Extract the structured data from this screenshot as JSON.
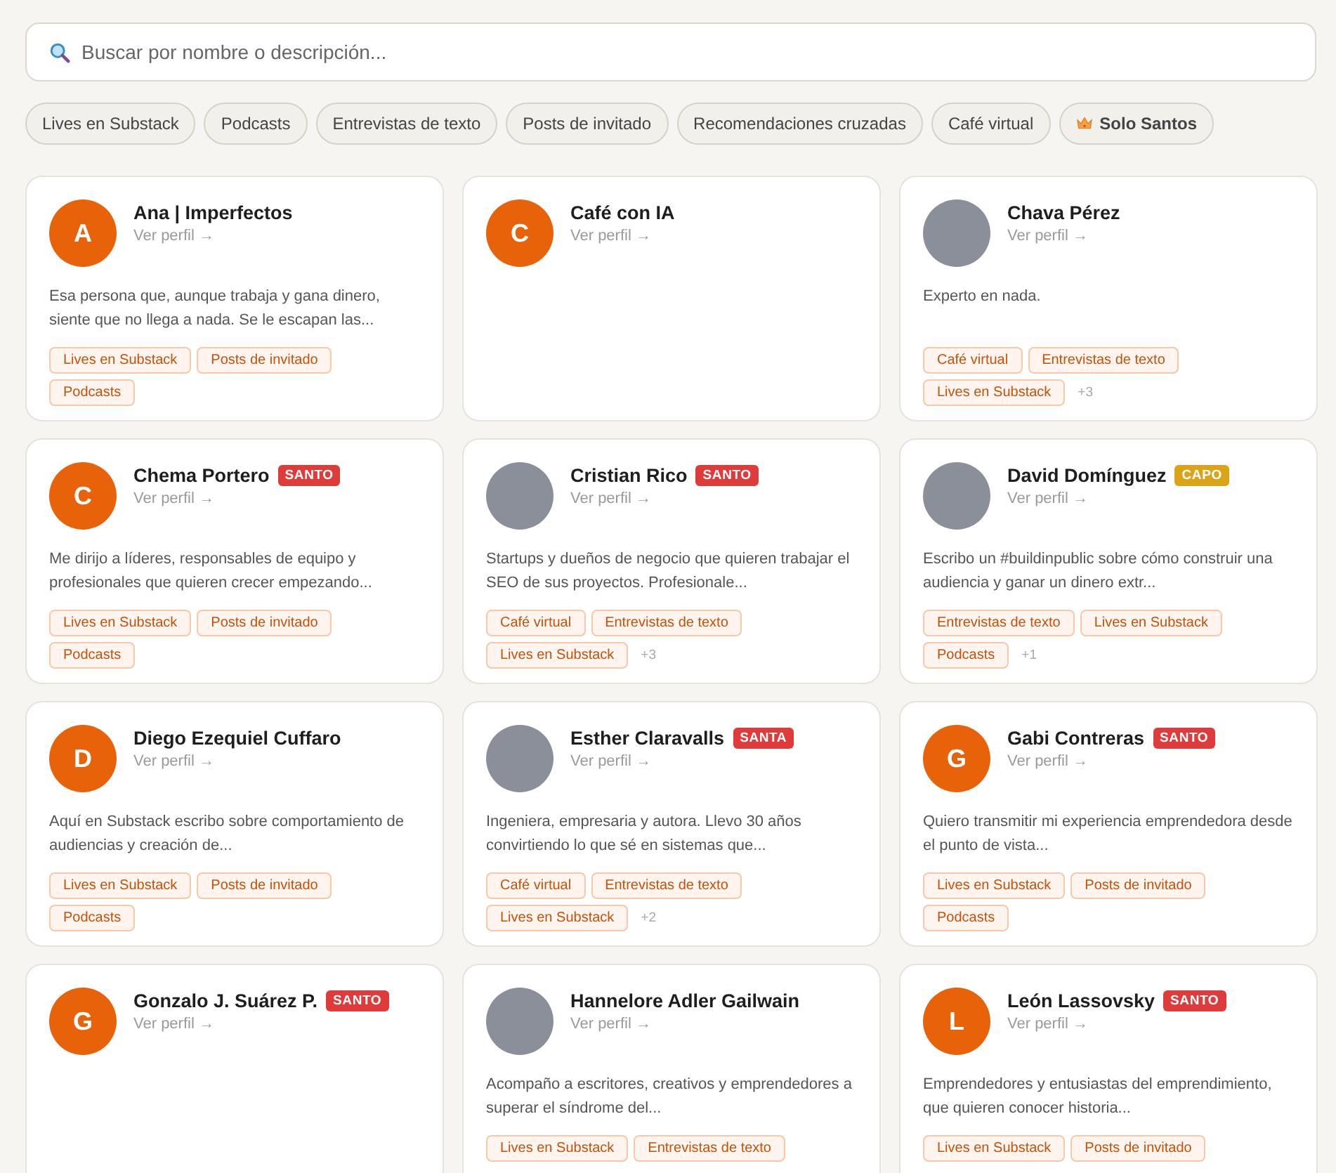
{
  "search": {
    "placeholder": "Buscar por nombre o descripción..."
  },
  "filters": [
    "Lives en Substack",
    "Podcasts",
    "Entrevistas de texto",
    "Posts de invitado",
    "Recomendaciones cruzadas",
    "Café virtual"
  ],
  "santos_filter": {
    "label": "Solo Santos"
  },
  "cards": [
    {
      "name": "Ana | Imperfectos",
      "avatar": {
        "kind": "initial",
        "letter": "A"
      },
      "link": "Ver perfil →",
      "description": "Esa persona que, aunque trabaja y gana dinero, siente que no llega a nada. Se le escapan las...",
      "tags": [
        "Lives en Substack",
        "Posts de invitado",
        "Podcasts"
      ]
    },
    {
      "name": "Café con IA",
      "avatar": {
        "kind": "initial",
        "letter": "C"
      },
      "link": "Ver perfil →"
    },
    {
      "name": "Chava Pérez",
      "avatar": {
        "kind": "photo"
      },
      "link": "Ver perfil →",
      "description": "Experto en nada.",
      "tags": [
        "Café virtual",
        "Entrevistas de texto",
        "Lives en Substack"
      ],
      "more": "+3"
    },
    {
      "name": "Chema Portero",
      "badge": {
        "text": "SANTO",
        "color": "#e03b3b"
      },
      "avatar": {
        "kind": "initial",
        "letter": "C"
      },
      "link": "Ver perfil →",
      "description": "Me dirijo a líderes, responsables de equipo y profesionales que quieren crecer empezando...",
      "tags": [
        "Lives en Substack",
        "Posts de invitado",
        "Podcasts"
      ]
    },
    {
      "name": "Cristian Rico",
      "badge": {
        "text": "SANTO",
        "color": "#e03b3b"
      },
      "avatar": {
        "kind": "photo"
      },
      "link": "Ver perfil →",
      "description": "Startups y dueños de negocio que quieren trabajar el SEO de sus proyectos. Profesionale...",
      "tags": [
        "Café virtual",
        "Entrevistas de texto",
        "Lives en Substack"
      ],
      "more": "+3"
    },
    {
      "name": "David Domínguez",
      "badge": {
        "text": "CAPO",
        "color": "#dba317"
      },
      "avatar": {
        "kind": "photo"
      },
      "link": "Ver perfil →",
      "description": "Escribo un #buildinpublic sobre cómo construir una audiencia y ganar un dinero extr...",
      "tags": [
        "Entrevistas de texto",
        "Lives en Substack",
        "Podcasts"
      ],
      "more": "+1"
    },
    {
      "name": "Diego Ezequiel Cuffaro",
      "avatar": {
        "kind": "initial",
        "letter": "D"
      },
      "link": "Ver perfil →",
      "description": "Aquí en Substack escribo sobre comportamiento de audiencias y creación de...",
      "tags": [
        "Lives en Substack",
        "Posts de invitado",
        "Podcasts"
      ]
    },
    {
      "name": "Esther Claravalls",
      "badge": {
        "text": "SANTA",
        "color": "#e03b3b"
      },
      "avatar": {
        "kind": "photo"
      },
      "link": "Ver perfil →",
      "description": "Ingeniera, empresaria y autora. Llevo 30 años convirtiendo lo que sé en sistemas que...",
      "tags": [
        "Café virtual",
        "Entrevistas de texto",
        "Lives en Substack"
      ],
      "more": "+2"
    },
    {
      "name": "Gabi Contreras",
      "badge": {
        "text": "SANTO",
        "color": "#e03b3b"
      },
      "avatar": {
        "kind": "initial",
        "letter": "G"
      },
      "link": "Ver perfil →",
      "description": "Quiero transmitir mi experiencia emprendedora desde el punto de vista...",
      "tags": [
        "Lives en Substack",
        "Posts de invitado",
        "Podcasts"
      ]
    },
    {
      "name": "Gonzalo J. Suárez P.",
      "badge": {
        "text": "SANTO",
        "color": "#e03b3b"
      },
      "avatar": {
        "kind": "initial",
        "letter": "G"
      },
      "link": "Ver perfil →"
    },
    {
      "name": "Hannelore Adler Gailwain",
      "avatar": {
        "kind": "photo"
      },
      "link": "Ver perfil →",
      "description": "Acompaño a escritores, creativos y emprendedores a superar el síndrome del...",
      "tags": [
        "Lives en Substack",
        "Entrevistas de texto"
      ]
    },
    {
      "name": "León Lassovsky",
      "badge": {
        "text": "SANTO",
        "color": "#e03b3b"
      },
      "avatar": {
        "kind": "initial",
        "letter": "L"
      },
      "link": "Ver perfil →",
      "description": "Emprendedores y entusiastas del emprendimiento, que quieren conocer historia...",
      "tags": [
        "Lives en Substack",
        "Posts de invitado"
      ]
    }
  ]
}
